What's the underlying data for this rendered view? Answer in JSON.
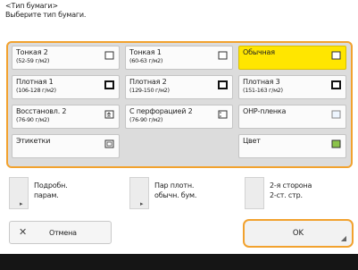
{
  "header": {
    "line1": "<Тип бумаги>",
    "line2": "Выберите тип бумаги."
  },
  "paper_types": [
    {
      "name": "Тонкая 2",
      "weight": "(52-59 г/м2)",
      "icon": "blank-page-icon",
      "selected": false
    },
    {
      "name": "Тонкая 1",
      "weight": "(60-63 г/м2)",
      "icon": "blank-page-icon",
      "selected": false
    },
    {
      "name": "Обычная",
      "weight": "",
      "icon": "blank-page-icon",
      "selected": true
    },
    {
      "name": "Плотная 1",
      "weight": "(106-128 г/м2)",
      "icon": "thick-page-icon",
      "selected": false
    },
    {
      "name": "Плотная 2",
      "weight": "(129-150 г/м2)",
      "icon": "thick-page-icon",
      "selected": false
    },
    {
      "name": "Плотная 3",
      "weight": "(151-163 г/м2)",
      "icon": "thick-page-icon",
      "selected": false
    },
    {
      "name": "Восстановл. 2",
      "weight": "(76-90 г/м2)",
      "icon": "recycled-page-icon",
      "selected": false
    },
    {
      "name": "С перфорацией 2",
      "weight": "(76-90 г/м2)",
      "icon": "punched-page-icon",
      "selected": false
    },
    {
      "name": "ОНР-пленка",
      "weight": "",
      "icon": "transparency-icon",
      "selected": false
    },
    {
      "name": "Этикетки",
      "weight": "",
      "icon": "label-page-icon",
      "selected": false
    },
    {
      "name": "",
      "weight": "",
      "icon": "",
      "selected": false
    },
    {
      "name": "Цвет",
      "weight": "",
      "icon": "color-page-icon",
      "selected": false
    }
  ],
  "options": {
    "details": "Подробн. парам.",
    "details_l1": "Подробн.",
    "details_l2": "парам.",
    "thick_l1": "Пар плотн.",
    "thick_l2": "обычн. бум.",
    "side2_l1": "2-я сторона",
    "side2_l2": "2-ст. стр."
  },
  "actions": {
    "cancel_label": "Отмена",
    "ok_label": "OK"
  },
  "colors": {
    "accent": "#f2a22e",
    "selected": "#ffe600",
    "color_icon": "#8bc34a"
  }
}
